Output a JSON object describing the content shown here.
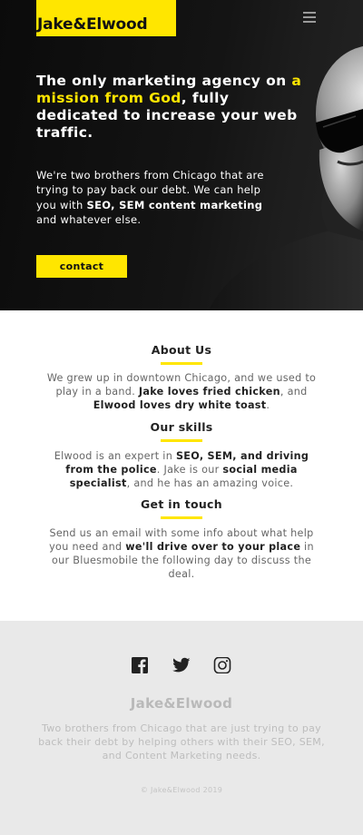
{
  "header": {
    "logo": "Jake&Elwood",
    "menu_icon": "hamburger-icon"
  },
  "hero": {
    "title_part1": "The only marketing agency on ",
    "title_highlight": "a mission from God",
    "title_part2": ", fully dedicated to increase your web traffic.",
    "sub_part1": "We're two brothers from Chicago that are trying to pay back our debt. We can help you with ",
    "sub_bold": "SEO, SEM content marketing",
    "sub_part2": " and whatever else.",
    "contact_label": "contact"
  },
  "about": {
    "heading": "About Us",
    "p1": "We grew up in downtown Chicago, and we used to play in a band. ",
    "b1": "Jake loves fried chicken",
    "p2": ", and ",
    "b2": "Elwood loves dry white toast",
    "p3": "."
  },
  "skills": {
    "heading": "Our skills",
    "p1": "Elwood is an expert in ",
    "b1": "SEO, SEM, and driving from the police",
    "p2": ". Jake is our ",
    "b2": "social media specialist",
    "p3": ", and he has an amazing voice."
  },
  "contact": {
    "heading": "Get in touch",
    "p1": "Send us an email with some info about what help you need and ",
    "b1": "we'll drive over to your place",
    "p2": " in our Bluesmobile the following day to discuss the deal."
  },
  "footer": {
    "social": [
      "facebook-icon",
      "twitter-icon",
      "instagram-icon"
    ],
    "logo": "Jake&Elwood",
    "text": "Two brothers from Chicago that are just trying to pay back their debt by helping others with their SEO, SEM, and Content Marketing needs.",
    "copyright": "© Jake&Elwood 2019"
  },
  "colors": {
    "accent": "#ffe600",
    "hero_bg": "#111111",
    "footer_bg": "#e9e9e9"
  }
}
